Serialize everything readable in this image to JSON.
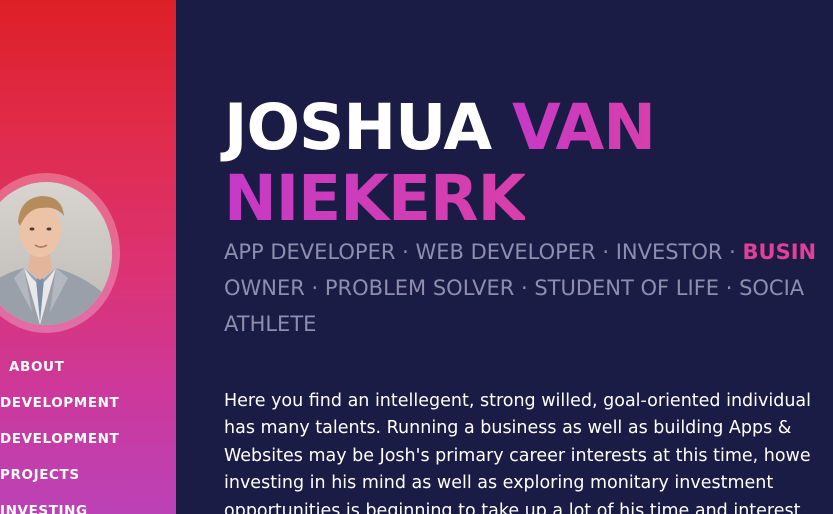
{
  "profile": {
    "first_name": "JOSHUA",
    "last_name_part1": "VAN",
    "last_name_part2": "NIEKERK"
  },
  "roles": {
    "line1_a": "APP DEVELOPER · WEB DEVELOPER · INVESTOR · ",
    "line1_highlight": "BUSIN",
    "line2": "OWNER · PROBLEM SOLVER · STUDENT OF LIFE · SOCIA",
    "line3": "ATHLETE"
  },
  "bio": {
    "lines": [
      "Here you find an intellegent, strong willed, goal-oriented individual",
      "has many talents. Running a business as well as building Apps &",
      "Websites may be Josh's primary career interests at this time, howe",
      "investing in his mind as well as exploring monitary investment",
      "opportunities is beginning to take up a lot of his time and interest"
    ]
  },
  "nav": {
    "items": [
      {
        "label": "ABOUT"
      },
      {
        "label": "DEVELOPMENT"
      },
      {
        "label": "DEVELOPMENT"
      },
      {
        "label": "PROJECTS"
      },
      {
        "label": "INVESTING"
      }
    ]
  },
  "colors": {
    "background": "#1b1c45",
    "sidebar_top": "#dd1f27",
    "sidebar_bottom": "#bb42b6",
    "accent": "#d83fa9",
    "muted_text": "#8d8fb0"
  },
  "icons": {
    "avatar": "profile-photo"
  }
}
